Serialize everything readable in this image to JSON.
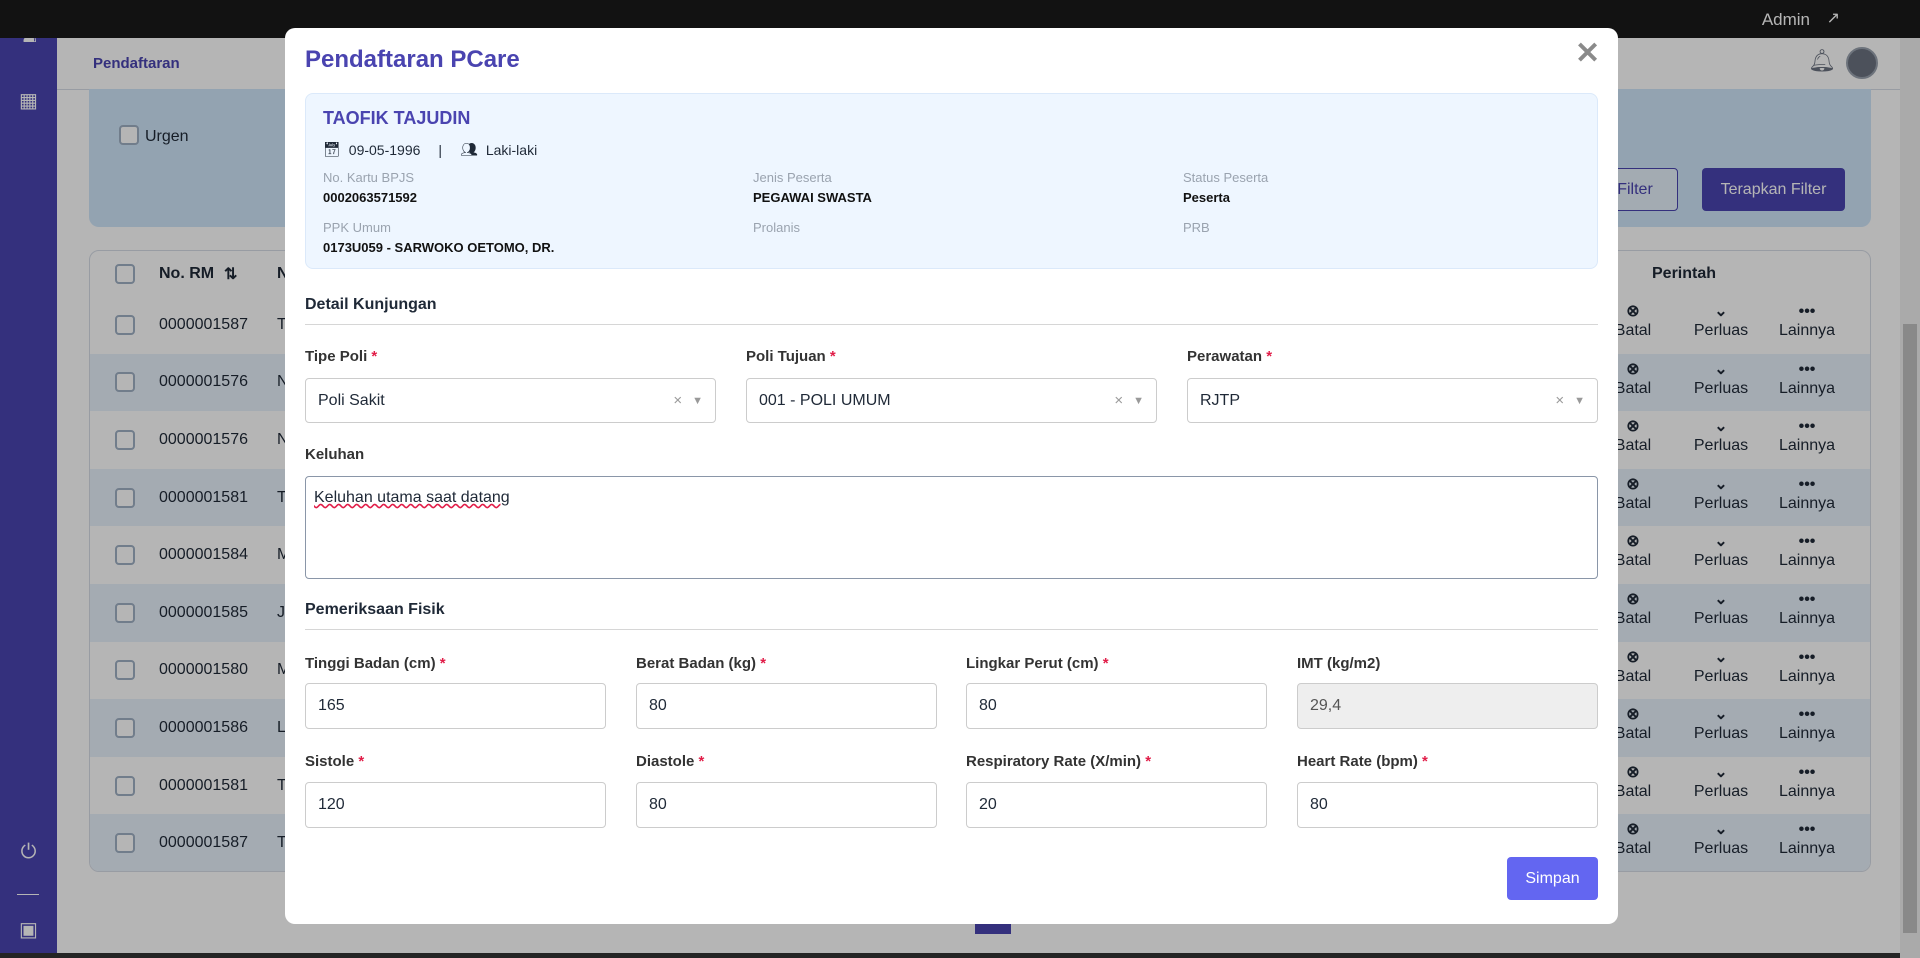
{
  "topbar": {
    "user": "Admin"
  },
  "header": {
    "nav": "Pendaftaran"
  },
  "filter": {
    "urgen_label": "Urgen",
    "filter_button": "Filter",
    "apply_button": "Terapkan Filter"
  },
  "table": {
    "headers": {
      "no_rm": "No. RM",
      "name": "N",
      "perintah": "Perintah"
    },
    "actions": {
      "batal": "Batal",
      "perluas": "Perluas",
      "lainnya": "Lainnya"
    },
    "rows": [
      {
        "no_rm": "0000001587",
        "name": "T"
      },
      {
        "no_rm": "0000001576",
        "name": "N"
      },
      {
        "no_rm": "0000001576",
        "name": "N"
      },
      {
        "no_rm": "0000001581",
        "name": "T"
      },
      {
        "no_rm": "0000001584",
        "name": "M"
      },
      {
        "no_rm": "0000001585",
        "name": "JU"
      },
      {
        "no_rm": "0000001580",
        "name": "M"
      },
      {
        "no_rm": "0000001586",
        "name": "L"
      },
      {
        "no_rm": "0000001581",
        "name": "T"
      },
      {
        "no_rm": "0000001587",
        "name": "T"
      }
    ]
  },
  "modal": {
    "title": "Pendaftaran PCare",
    "patient": {
      "name": "TAOFIK TAJUDIN",
      "dob": "09-05-1996",
      "separator": "|",
      "gender": "Laki-laki",
      "fields": [
        {
          "label": "No. Kartu BPJS",
          "value": "0002063571592"
        },
        {
          "label": "Jenis Peserta",
          "value": "PEGAWAI SWASTA"
        },
        {
          "label": "Status Peserta",
          "value": "Peserta"
        },
        {
          "label": "PPK Umum",
          "value": "0173U059 - SARWOKO OETOMO, DR."
        },
        {
          "label": "Prolanis",
          "value": ""
        },
        {
          "label": "PRB",
          "value": ""
        }
      ]
    },
    "detail": {
      "title": "Detail Kunjungan",
      "tipe_poli": {
        "label": "Tipe Poli",
        "value": "Poli Sakit"
      },
      "poli_tujuan": {
        "label": "Poli Tujuan",
        "value": "001 - POLI UMUM"
      },
      "perawatan": {
        "label": "Perawatan",
        "value": "RJTP"
      },
      "keluhan": {
        "label": "Keluhan",
        "value": "Keluhan utama saat datang"
      }
    },
    "fisik": {
      "title": "Pemeriksaan Fisik",
      "fields": [
        {
          "label": "Tinggi Badan (cm)",
          "value": "165",
          "required": true
        },
        {
          "label": "Berat Badan (kg)",
          "value": "80",
          "required": true
        },
        {
          "label": "Lingkar Perut (cm)",
          "value": "80",
          "required": true
        },
        {
          "label": "IMT (kg/m2)",
          "value": "29,4",
          "required": false
        },
        {
          "label": "Sistole",
          "value": "120",
          "required": true
        },
        {
          "label": "Diastole",
          "value": "80",
          "required": true
        },
        {
          "label": "Respiratory Rate (X/min)",
          "value": "20",
          "required": true
        },
        {
          "label": "Heart Rate (bpm)",
          "value": "80",
          "required": true
        }
      ]
    },
    "save_button": "Simpan",
    "required_mark": "*"
  }
}
